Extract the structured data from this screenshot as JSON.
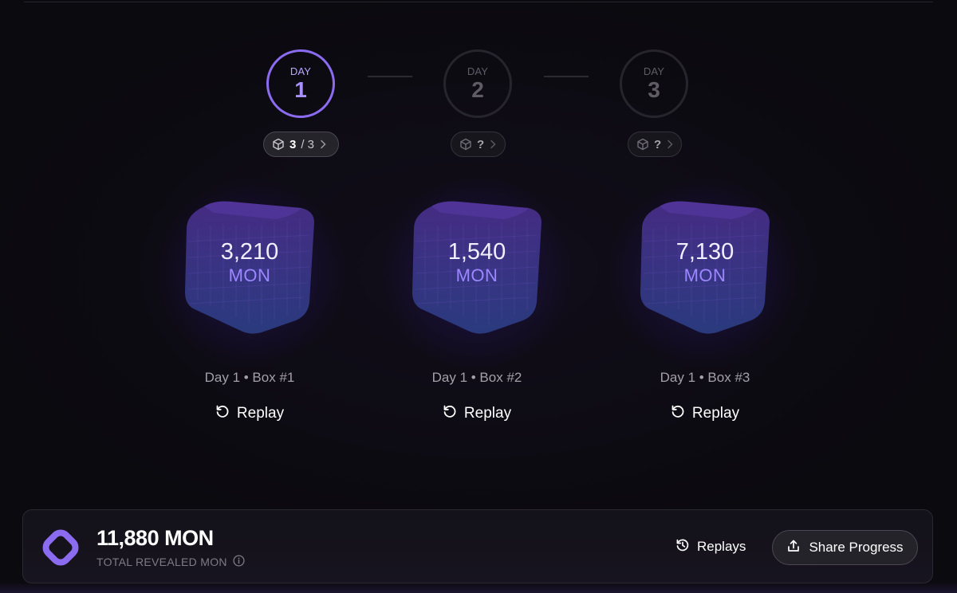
{
  "days": [
    {
      "label": "DAY",
      "number": "1",
      "active": true,
      "count_current": "3",
      "count_sep": "/ 3"
    },
    {
      "label": "DAY",
      "number": "2",
      "active": false,
      "count_current": "?",
      "count_sep": ""
    },
    {
      "label": "DAY",
      "number": "3",
      "active": false,
      "count_current": "?",
      "count_sep": ""
    }
  ],
  "boxes": [
    {
      "value": "3,210",
      "unit": "MON",
      "caption": "Day 1 • Box #1",
      "replay_label": "Replay"
    },
    {
      "value": "1,540",
      "unit": "MON",
      "caption": "Day 1 • Box #2",
      "replay_label": "Replay"
    },
    {
      "value": "7,130",
      "unit": "MON",
      "caption": "Day 1 • Box #3",
      "replay_label": "Replay"
    }
  ],
  "footer": {
    "total_value": "11,880 MON",
    "total_label": "TOTAL REVEALED MON",
    "replays_label": "Replays",
    "share_label": "Share Progress"
  },
  "colors": {
    "accent": "#8b6cf0",
    "background": "#0b0a0f"
  },
  "icons": {
    "box": "cube-icon",
    "chevron": "chevron-right-icon",
    "replay": "replay-icon",
    "history": "history-icon",
    "share": "share-icon",
    "info": "info-icon",
    "logo": "monad-logo-icon"
  }
}
